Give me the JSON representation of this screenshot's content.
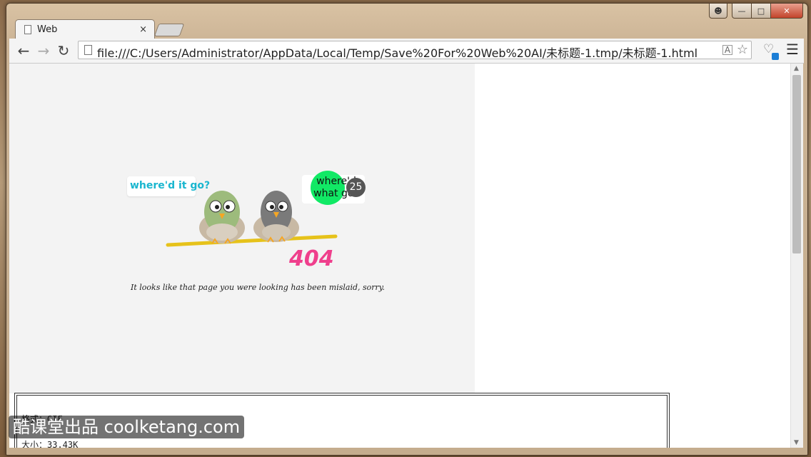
{
  "browser": {
    "tab_title": "Web",
    "tab_close": "×",
    "url": "file:///C:/Users/Administrator/AppData/Local/Temp/Save%20For%20Web%20AI/未标题-1.tmp/未标题-1.html"
  },
  "page": {
    "bubble_left": "where'd it go?",
    "bubble_right": "where'd what go?",
    "counter": "25",
    "error_code": "404",
    "tagline": "It looks like that page you were looking has been mislaid, sorry."
  },
  "info": {
    "format_label": "格式：GIF",
    "size_label": "大小：33.43K"
  },
  "watermark": "酷课堂出品 coolketang.com",
  "colors": {
    "accent_green": "#11e965",
    "error_pink": "#ef3f8c",
    "bubble_cyan": "#19b6cf"
  }
}
